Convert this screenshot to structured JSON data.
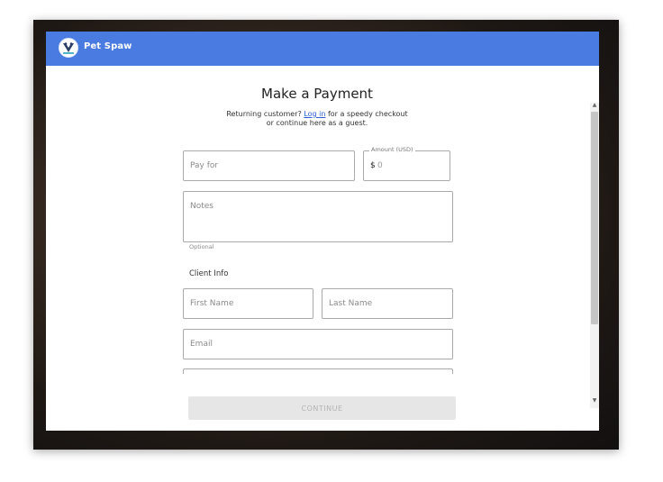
{
  "brand": {
    "name": "Pet Spaw"
  },
  "page": {
    "title": "Make a Payment",
    "subtitle_prefix": "Returning customer?",
    "login_link": "Log in",
    "subtitle_suffix": "for a speedy checkout",
    "subtitle_line2": "or continue here as a guest."
  },
  "form": {
    "pay_for_placeholder": "Pay for",
    "amount_legend": "Amount (USD)",
    "currency_symbol": "$",
    "amount_placeholder": "0",
    "notes_placeholder": "Notes",
    "notes_hint": "Optional",
    "client_info_heading": "Client Info",
    "first_name_placeholder": "First Name",
    "last_name_placeholder": "Last Name",
    "email_placeholder": "Email"
  },
  "actions": {
    "continue_label": "CONTINUE"
  },
  "colors": {
    "header": "#4a7be0",
    "link": "#2a5fd0",
    "button_disabled": "#e6e6e6"
  },
  "icons": {
    "logo": "pet-spaw-logo-icon",
    "scroll_up": "chevron-up-icon",
    "scroll_down": "chevron-down-icon"
  }
}
